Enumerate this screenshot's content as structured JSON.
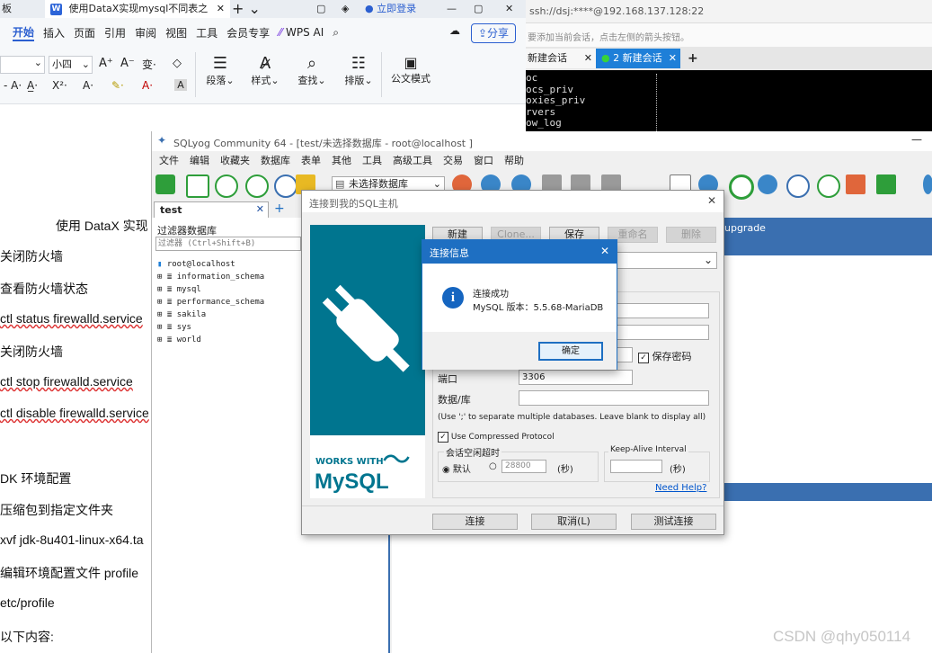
{
  "wps": {
    "tabs": [
      "板",
      "使用DataX实现mysql不同表之"
    ],
    "login": "立即登录",
    "share": "分享",
    "menu": [
      "开始",
      "插入",
      "页面",
      "引用",
      "审阅",
      "视图",
      "工具",
      "会员专享",
      "WPS AI"
    ],
    "font_size": "小四",
    "ribbon": {
      "paragraph": "段落",
      "style": "样式",
      "find": "查找",
      "layout": "排版",
      "official": "公文模式"
    },
    "doc_title": "使用 DataX 实现",
    "doc_lines": [
      "关闭防火墙",
      "查看防火墙状态",
      "ctl status firewalld.service",
      "关闭防火墙",
      "ctl stop firewalld.service",
      "ctl disable firewalld.service",
      "DK 环境配置",
      "压缩包到指定文件夹",
      "xvf   jdk-8u401-linux-x64.ta",
      "编辑环境配置文件 profile",
      "etc/profile",
      "以下内容:"
    ]
  },
  "ssh": {
    "address": "ssh://dsj:****@192.168.137.128:22",
    "hint": "要添加当前会话，点击左侧的箭头按钮。",
    "tab1": "新建会话",
    "tab2": "2 新建会话",
    "terminal_lines": [
      "oc",
      "ocs_priv",
      "oxies_priv",
      "rvers",
      "ow_log"
    ]
  },
  "sqlyog": {
    "title": "SQLyog Community 64 - [test/未选择数据库 - root@localhost ]",
    "menu": [
      "文件",
      "编辑",
      "收藏夹",
      "数据库",
      "表单",
      "其他",
      "工具",
      "高级工具",
      "交易",
      "窗口",
      "帮助"
    ],
    "db_select": "未选择数据库",
    "tab": "test",
    "filter_label": "过滤器数据库",
    "filter_placeholder": "过滤器 (Ctrl+Shift+B)",
    "tree": [
      "root@localhost",
      "information_schema",
      "mysql",
      "performance_schema",
      "sakila",
      "sys",
      "world"
    ],
    "right_text": "upgrade"
  },
  "dialog": {
    "title": "连接到我的SQL主机",
    "buttons": {
      "new": "新建",
      "clone": "Clone...",
      "save": "保存",
      "rename": "重命名",
      "delete": "删除"
    },
    "save_password": "保存密码",
    "port_label": "端口",
    "port_value": "3306",
    "database_label": "数据/库",
    "db_hint": "(Use ';' to separate multiple databases. Leave blank to display all)",
    "compressed": "Use Compressed Protocol",
    "idle_group": "会话空闲超时",
    "idle_default": "默认",
    "idle_value": "28800",
    "seconds": "(秒)",
    "keepalive": "Keep-Alive Interval",
    "need_help": "Need Help?",
    "connect": "连接",
    "cancel": "取消(L)",
    "test": "测试连接",
    "logo_works": "WORKS WITH",
    "logo_mysql": "MySQL"
  },
  "msgbox": {
    "title": "连接信息",
    "line1": "连接成功",
    "line2": "MySQL 版本：5.5.68-MariaDB",
    "ok": "确定"
  },
  "watermark": "CSDN @qhy050114",
  "colors": {
    "sqlyog_blue": "#3a6fb0",
    "mysql_blue": "#00758f",
    "mysql_orange": "#f29111",
    "info_blue": "#1565c0"
  }
}
